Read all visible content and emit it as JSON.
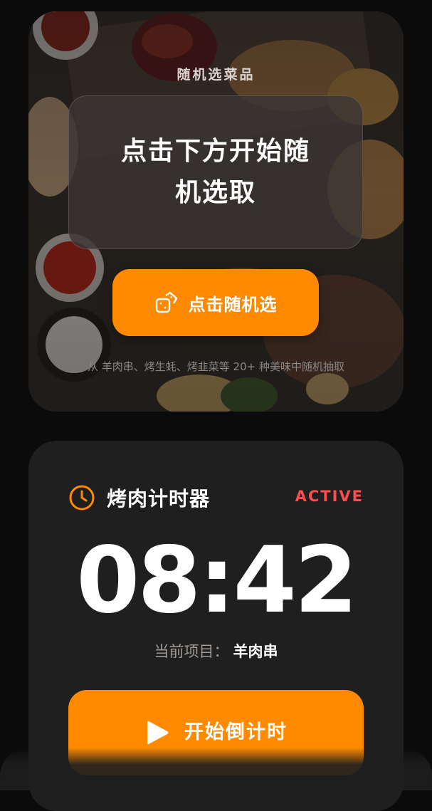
{
  "picker": {
    "title": "随机选菜品",
    "result_line1": "点击下方开始随",
    "result_line2": "机选取",
    "button_label": "点击随机选",
    "button_icon": "dice-icon",
    "hint": "从 羊肉串、烤生蚝、烤韭菜等 20+ 种美味中随机抽取"
  },
  "timer": {
    "title": "烤肉计时器",
    "title_icon": "clock-icon",
    "status": "ACTIVE",
    "value": "08:42",
    "current_label": "当前项目：",
    "current_value": "羊肉串",
    "start_label": "开始倒计时",
    "start_icon": "play-icon"
  },
  "colors": {
    "accent": "#ff8a00",
    "status": "#ff4d4d",
    "background": "#0b0b0b",
    "card": "#1f1f1f"
  }
}
